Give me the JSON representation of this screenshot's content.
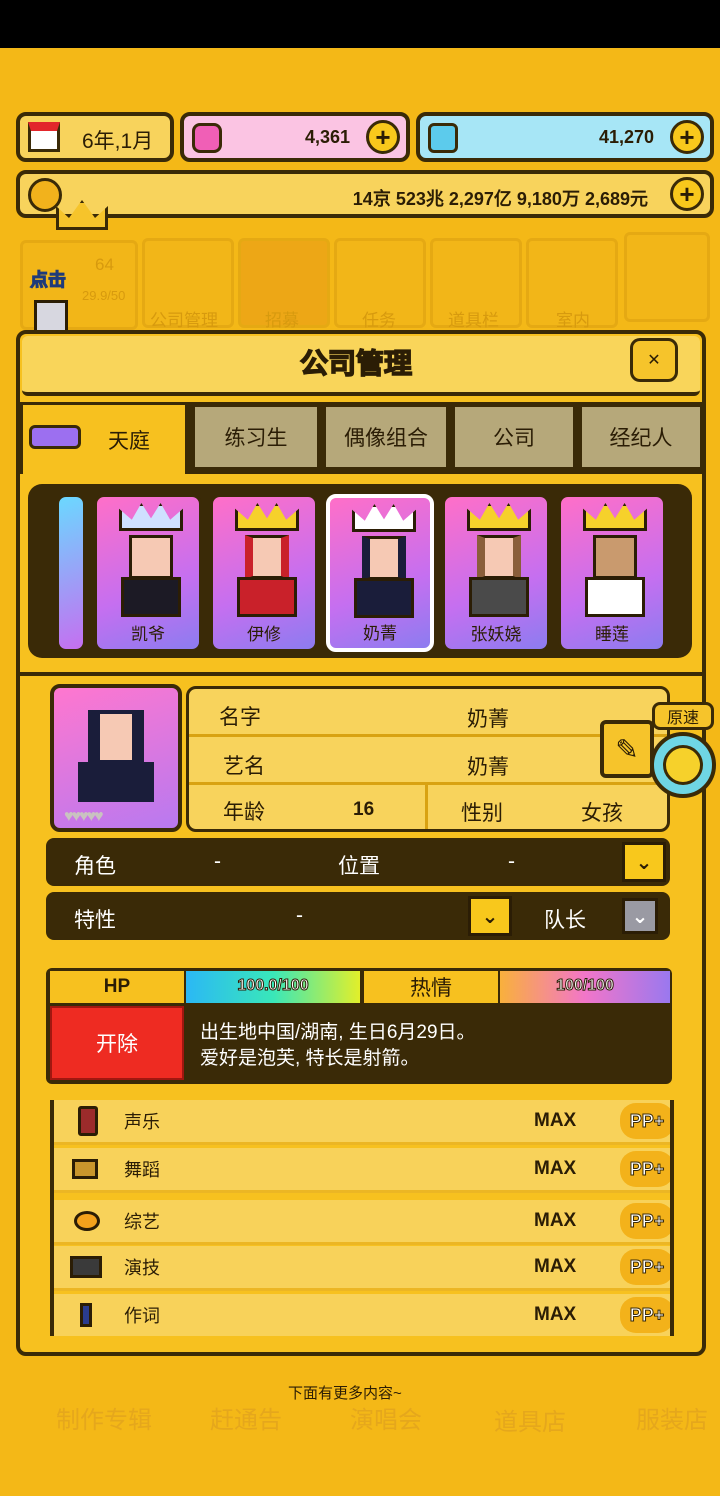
{
  "top": {
    "date": "6年,1月",
    "gems": "4,361",
    "diamonds": "41,270",
    "money": "14京 523兆 2,297亿 9,180万 2,689元"
  },
  "bg_menu": {
    "level": "64",
    "exp": "29.9/50",
    "items": [
      "公司管理",
      "招募",
      "任务",
      "道具栏",
      "室内"
    ],
    "bottom": [
      "制作专辑",
      "赶通告",
      "演唱会",
      "道具店",
      "服装店"
    ]
  },
  "click_hint": "点击",
  "dialog": {
    "title": "公司管理",
    "tabs": [
      "天庭",
      "练习生",
      "偶像组合",
      "公司",
      "经纪人"
    ],
    "members": [
      "凯爷",
      "伊修",
      "奶菁",
      "张妖娆",
      "睡莲"
    ],
    "selected_member": "奶菁",
    "info": {
      "name_label": "名字",
      "name_value": "奶菁",
      "stage_label": "艺名",
      "stage_value": "奶菁",
      "age_label": "年龄",
      "age_value": "16",
      "gender_label": "性别",
      "gender_value": "女孩"
    },
    "speed_label": "原速",
    "role_label": "角色",
    "role_value": "-",
    "position_label": "位置",
    "position_value": "-",
    "trait_label": "特性",
    "trait_value": "-",
    "leader_label": "队长",
    "hp_label": "HP",
    "hp_value": "100.0/100",
    "hp_fraction": 1.0,
    "passion_label": "热情",
    "passion_value": "100/100",
    "passion_fraction": 1.0,
    "fire_button": "开除",
    "bio_line1": "出生地中国/湖南, 生日6月29日。",
    "bio_line2": "爱好是泡芙, 特长是射箭。",
    "skills": [
      {
        "name": "声乐",
        "value": "MAX",
        "button": "PP+",
        "icon": "microphone-icon"
      },
      {
        "name": "舞蹈",
        "value": "MAX",
        "button": "PP+",
        "icon": "dance-shoe-icon"
      },
      {
        "name": "综艺",
        "value": "MAX",
        "button": "PP+",
        "icon": "variety-mask-icon"
      },
      {
        "name": "演技",
        "value": "MAX",
        "button": "PP+",
        "icon": "camera-icon"
      },
      {
        "name": "作词",
        "value": "MAX",
        "button": "PP+",
        "icon": "pen-icon"
      }
    ]
  },
  "more_hint": "下面有更多内容~",
  "colors": {
    "bg": "#f4b817",
    "dark": "#3a2a07",
    "fire": "#ee2b22",
    "gem_pink": "#fbc4e3",
    "diamond_blue": "#a7e6f6"
  }
}
